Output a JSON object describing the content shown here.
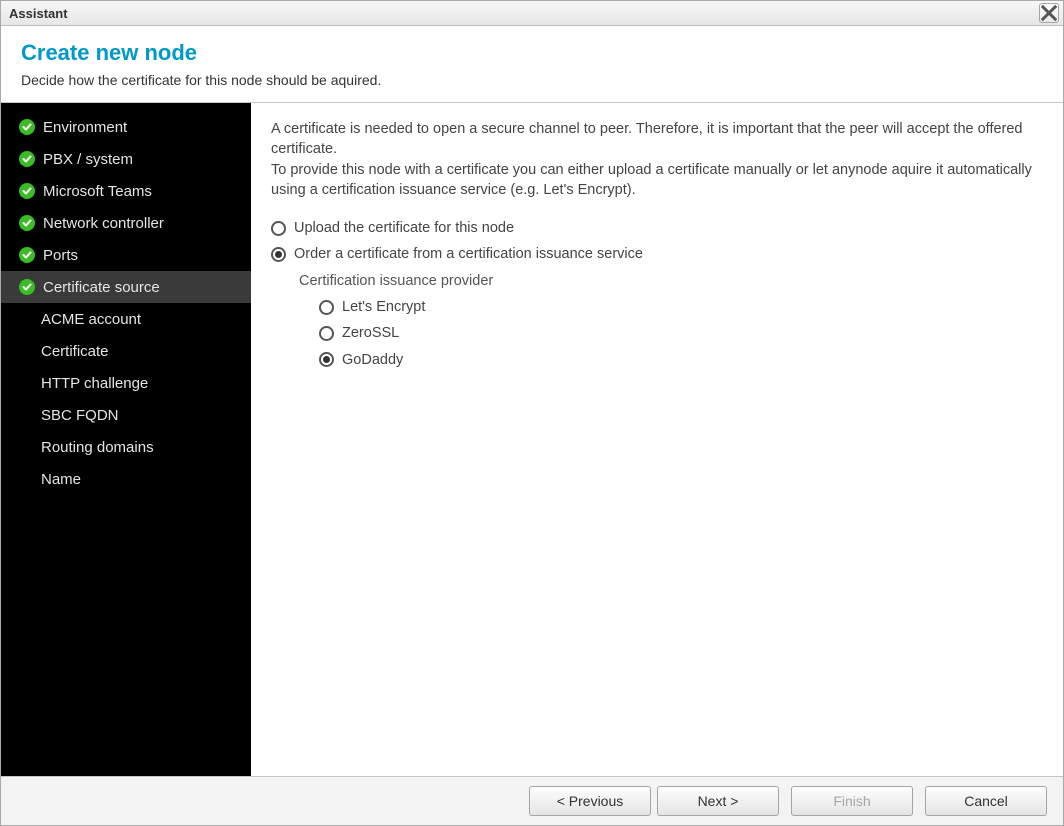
{
  "window": {
    "title": "Assistant"
  },
  "header": {
    "title": "Create new node",
    "subtitle": "Decide how the certificate for this node should be aquired."
  },
  "sidebar": {
    "items": [
      {
        "label": "Environment",
        "completed": true,
        "active": false,
        "sub": false
      },
      {
        "label": "PBX / system",
        "completed": true,
        "active": false,
        "sub": false
      },
      {
        "label": "Microsoft Teams",
        "completed": true,
        "active": false,
        "sub": false
      },
      {
        "label": "Network controller",
        "completed": true,
        "active": false,
        "sub": false
      },
      {
        "label": "Ports",
        "completed": true,
        "active": false,
        "sub": false
      },
      {
        "label": "Certificate source",
        "completed": true,
        "active": true,
        "sub": false
      },
      {
        "label": "ACME account",
        "completed": false,
        "active": false,
        "sub": true
      },
      {
        "label": "Certificate",
        "completed": false,
        "active": false,
        "sub": true
      },
      {
        "label": "HTTP challenge",
        "completed": false,
        "active": false,
        "sub": true
      },
      {
        "label": "SBC FQDN",
        "completed": false,
        "active": false,
        "sub": true
      },
      {
        "label": "Routing domains",
        "completed": false,
        "active": false,
        "sub": true
      },
      {
        "label": "Name",
        "completed": false,
        "active": false,
        "sub": true
      }
    ]
  },
  "content": {
    "intro_line1": "A certificate is needed to open a secure channel to peer. Therefore, it is important that the peer will accept the offered certificate.",
    "intro_line2": "To provide this node with a certificate you can either upload a certificate manually or let anynode aquire it automatically using a certification issuance service (e.g. Let's Encrypt).",
    "option_upload": "Upload the certificate for this node",
    "option_order": "Order a certificate from a certification issuance service",
    "provider_heading": "Certification issuance provider",
    "providers": [
      {
        "label": "Let's Encrypt",
        "selected": false
      },
      {
        "label": "ZeroSSL",
        "selected": false
      },
      {
        "label": "GoDaddy",
        "selected": true
      }
    ],
    "selected_main": "order"
  },
  "footer": {
    "previous": "< Previous",
    "next": "Next >",
    "finish": "Finish",
    "cancel": "Cancel"
  }
}
